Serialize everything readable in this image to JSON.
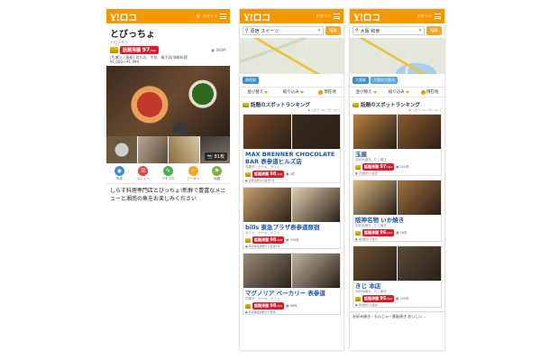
{
  "brand": {
    "logo": "Y!ロコ",
    "login": "ログイン",
    "accent": "#f39800",
    "rank_red": "#d51f2d"
  },
  "detail": {
    "title": "とびっちょ",
    "kana": "トビッチョ",
    "rank_label": "話題沸騰",
    "rank_value": "97",
    "rank_unit": "/100",
    "bookmark": "400件",
    "area": "[片瀬江ノ島駅] 丼もの、牛丼、親子丼/海鮮料理",
    "price": "¥1,000〜¥1,999",
    "photo_count": "81枚",
    "tabs": [
      {
        "label": "写真",
        "icon": "camera-icon",
        "color": "#3b8fd0"
      },
      {
        "label": "メニュー",
        "icon": "menu-book-icon",
        "color": "#e0463a"
      },
      {
        "label": "クチコミ",
        "icon": "review-icon",
        "color": "#4caf50"
      },
      {
        "label": "クーポン",
        "icon": "coupon-icon",
        "color": "#f5a623"
      },
      {
        "label": "地図",
        "icon": "map-pin-icon",
        "color": "#7cb342"
      }
    ],
    "description": "しらす料理専門店とびっちょ!新鮮で豊富なメニューと湘南の魚をお楽しみください"
  },
  "list1": {
    "query": "原宿 スイーツ",
    "search_btn": "検索",
    "chips": [
      "原宿駅"
    ],
    "sort": [
      "並び替え",
      "絞り込み",
      "現在地"
    ],
    "ranking_title": "話題のスポットランキング",
    "ranking_note": "このランキングについて",
    "cards": [
      {
        "name": "MAX BRENNER CHOCOLATE BAR 表参道ヒルズ店",
        "genre": "洋菓子、ケーキ、カフェ",
        "rank_value": "98",
        "count": "0件",
        "info": "表参道駅から徒歩3分",
        "imgs": [
          "#7a4a2a",
          "#3a2a20"
        ]
      },
      {
        "name": "bills 東急プラザ表参道原宿",
        "genre": "カフェ、ケーキ、カフェ",
        "rank_value": "98",
        "count": "335件",
        "info": "明治神宮前駅から徒歩1分",
        "imgs": [
          "#c8a070",
          "#e0d0b0"
        ]
      },
      {
        "name": "マグノリア ベーカリー 表参道",
        "genre": "洋菓子、ケーキ、カフェ",
        "rank_value": "98",
        "count": "86件",
        "info": "明治神宮前駅から徒歩",
        "imgs": [
          "#9a8a78",
          "#c0b4a0"
        ]
      }
    ],
    "footer_link": "詳細を見る"
  },
  "list2": {
    "query": "大阪 和食",
    "search_btn": "検索",
    "chips": [
      "大阪駅",
      "大阪府大阪市"
    ],
    "sort": [
      "並び替え",
      "絞り込み",
      "現在地"
    ],
    "ranking_title": "話題のスポットランキング",
    "ranking_note": "このランキングについて",
    "cards": [
      {
        "name": "玉屋",
        "genre": "お好み焼き、たこ焼き",
        "rank_value": "97",
        "count": "250件",
        "info": "大阪駅から徒歩",
        "imgs": [
          "#b88040",
          "#8a5a30"
        ]
      },
      {
        "name": "阪神名物 いか焼き",
        "genre": "お好み焼き、たこ焼き",
        "rank_value": "96",
        "count": "28件",
        "info": "梅田駅から徒歩",
        "imgs": [
          "#d8b880",
          "#a07040"
        ]
      },
      {
        "name": "きじ 本店",
        "genre": "お好み焼き、たこ焼き",
        "rank_value": "95",
        "count": "250件",
        "info": "梅田駅から徒歩",
        "imgs": [
          "#6a5030",
          "#5a4a38"
        ]
      }
    ],
    "bottom": "お好み焼き・もんじゃ・鉄板焼き おいしい…"
  }
}
